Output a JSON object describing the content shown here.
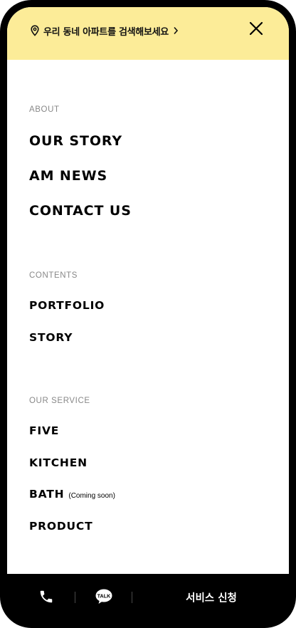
{
  "header": {
    "search_text": "우리 동네 아파트를 검색해보세요",
    "location_icon": "map-pin-icon",
    "chevron_icon": "chevron-right-icon",
    "close_icon": "close-icon",
    "background_color": "#fcec98"
  },
  "menu": {
    "about": {
      "label": "ABOUT",
      "items": [
        "OUR STORY",
        "AM NEWS",
        "CONTACT US"
      ]
    },
    "contents": {
      "label": "CONTENTS",
      "items": [
        "PORTFOLIO",
        "STORY"
      ]
    },
    "service": {
      "label": "OUR SERVICE",
      "items": [
        "FIVE",
        "KITCHEN",
        "BATH",
        "PRODUCT"
      ],
      "bath_note": "(Coming soon)"
    }
  },
  "bottom_bar": {
    "phone_icon": "phone-icon",
    "talk_icon": "kakao-talk-icon",
    "talk_badge": "TALK",
    "apply_label": "서비스 신청",
    "background_color": "#000000"
  }
}
